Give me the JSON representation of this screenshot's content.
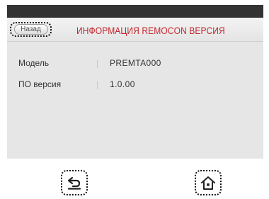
{
  "header": {
    "back_label": "Назад",
    "title": "ИНФОРМАЦИЯ REMOCON ВЕРСИЯ"
  },
  "info_rows": [
    {
      "label": "Модель",
      "value": "PREMTA000"
    },
    {
      "label": "ПО версия",
      "value": "1.0.00"
    }
  ],
  "nav": {
    "back_icon": "return-arrow-icon",
    "home_icon": "home-icon"
  },
  "colors": {
    "title": "#c4262e",
    "topbar": "#333333",
    "content_bg": "#e6e6e6"
  }
}
